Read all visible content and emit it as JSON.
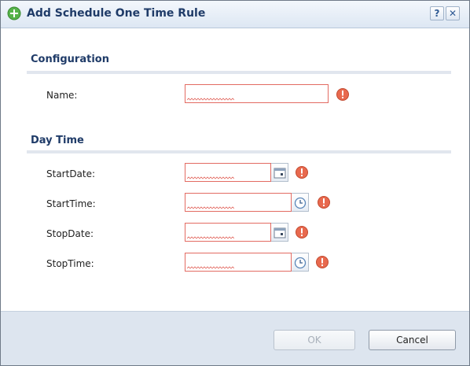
{
  "dialog": {
    "title": "Add Schedule One Time Rule",
    "help_label": "?",
    "close_label": "✕"
  },
  "configuration": {
    "heading": "Configuration",
    "name": {
      "label": "Name:",
      "value": "",
      "placeholder": ""
    }
  },
  "daytime": {
    "heading": "Day Time",
    "start_date": {
      "label": "StartDate:",
      "value": ""
    },
    "start_time": {
      "label": "StartTime:",
      "value": ""
    },
    "stop_date": {
      "label": "StopDate:",
      "value": ""
    },
    "stop_time": {
      "label": "StopTime:",
      "value": ""
    }
  },
  "footer": {
    "ok_label": "OK",
    "cancel_label": "Cancel"
  },
  "colors": {
    "accent": "#1f3b68",
    "error": "#e8694e",
    "field_border_invalid": "#e36b62"
  },
  "icons": {
    "title": "add-circle-icon",
    "error": "exclamation-icon",
    "date_picker": "calendar-icon",
    "time_picker": "clock-icon"
  }
}
